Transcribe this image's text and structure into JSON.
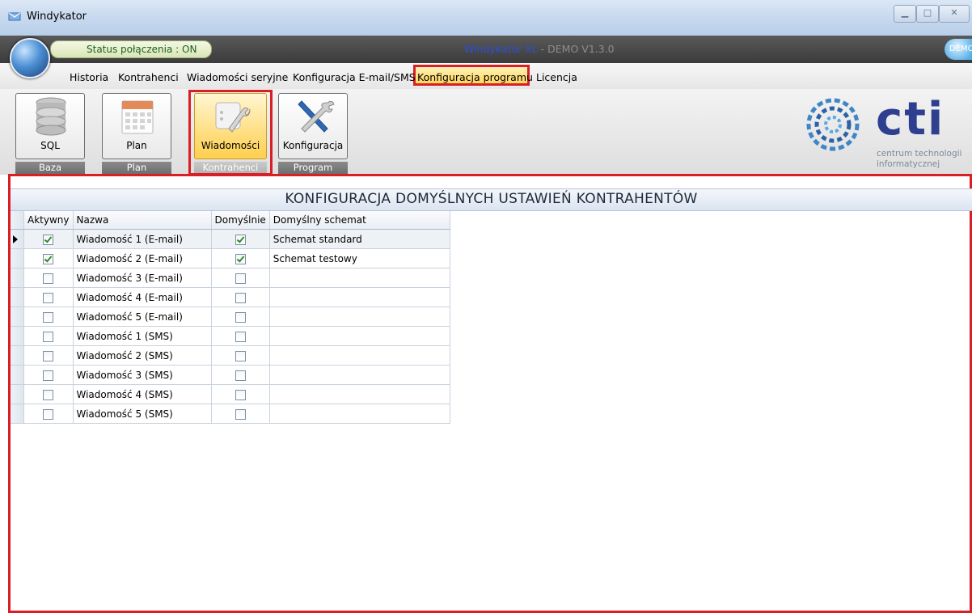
{
  "window": {
    "title": "Windykator"
  },
  "header": {
    "status_text": "Status połączenia : ON",
    "app_name": "Windykator XL",
    "app_version": " - DEMO V1.3.0",
    "demo_badge": "DEMO"
  },
  "menu": {
    "items": [
      "Historia",
      "Kontrahenci",
      "Wiadomości seryjne",
      "Konfiguracja E-mail/SMS",
      "Konfiguracja programu",
      "Licencja"
    ],
    "active": "Konfiguracja programu"
  },
  "ribbon": {
    "buttons": [
      {
        "label": "SQL",
        "icon": "database-icon"
      },
      {
        "label": "Plan",
        "icon": "calendar-icon"
      },
      {
        "label": "Wiadomości",
        "icon": "settings-wrench-icon"
      },
      {
        "label": "Konfiguracja",
        "icon": "wrench-screwdriver-icon"
      }
    ],
    "groups": [
      "Baza",
      "Plan",
      "Kontrahenci",
      "Program"
    ]
  },
  "logo": {
    "text": "cti",
    "subtitle_line1": "centrum technologii",
    "subtitle_line2": "informatycznej"
  },
  "section": {
    "title": "KONFIGURACJA DOMYŚLNYCH USTAWIEŃ KONTRAHENTÓW"
  },
  "table": {
    "columns": [
      "Aktywny",
      "Nazwa",
      "Domyślnie",
      "Domyślny schemat"
    ],
    "rows": [
      {
        "aktywny": true,
        "nazwa": "Wiadomość 1 (E-mail)",
        "domyslnie": true,
        "schemat": "Schemat standard"
      },
      {
        "aktywny": true,
        "nazwa": "Wiadomość 2 (E-mail)",
        "domyslnie": true,
        "schemat": "Schemat testowy"
      },
      {
        "aktywny": false,
        "nazwa": "Wiadomość 3 (E-mail)",
        "domyslnie": false,
        "schemat": ""
      },
      {
        "aktywny": false,
        "nazwa": "Wiadomość 4 (E-mail)",
        "domyslnie": false,
        "schemat": ""
      },
      {
        "aktywny": false,
        "nazwa": "Wiadomość 5 (E-mail)",
        "domyslnie": false,
        "schemat": ""
      },
      {
        "aktywny": false,
        "nazwa": "Wiadomość 1 (SMS)",
        "domyslnie": false,
        "schemat": ""
      },
      {
        "aktywny": false,
        "nazwa": "Wiadomość 2 (SMS)",
        "domyslnie": false,
        "schemat": ""
      },
      {
        "aktywny": false,
        "nazwa": "Wiadomość 3 (SMS)",
        "domyslnie": false,
        "schemat": ""
      },
      {
        "aktywny": false,
        "nazwa": "Wiadomość 4 (SMS)",
        "domyslnie": false,
        "schemat": ""
      },
      {
        "aktywny": false,
        "nazwa": "Wiadomość 5 (SMS)",
        "domyslnie": false,
        "schemat": ""
      }
    ],
    "selected_row": 0
  },
  "colors": {
    "highlight": "#d91f26",
    "accent": "#2a4fd8"
  }
}
